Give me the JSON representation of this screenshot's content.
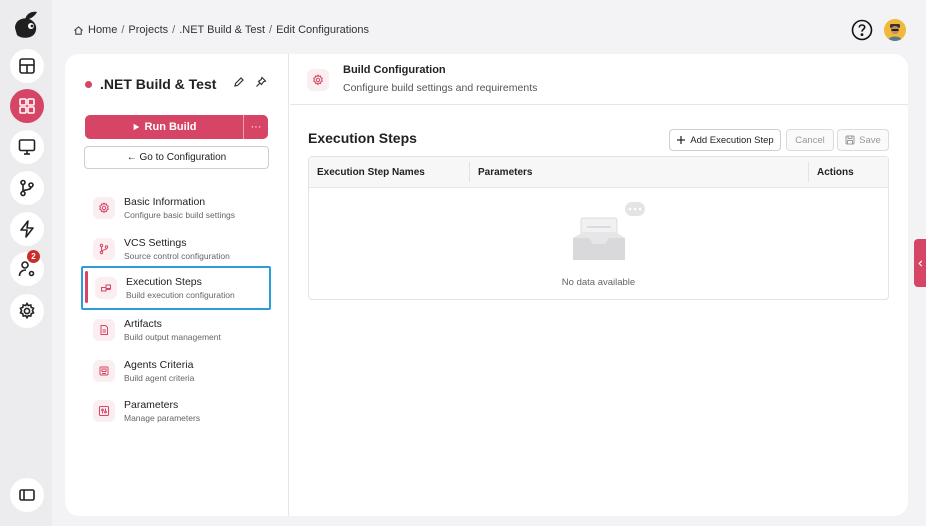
{
  "breadcrumb": {
    "items": [
      "Home",
      "Projects",
      ".NET Build & Test",
      "Edit Configurations"
    ],
    "separator": "/"
  },
  "rail": {
    "badge_count": "2",
    "accent": "#d64565"
  },
  "project": {
    "title": ".NET Build & Test",
    "run_label": "Run Build",
    "more_label": "···",
    "goto_label": "← Go to Configuration"
  },
  "nav": [
    {
      "label": "Basic Information",
      "sub": "Configure basic build settings",
      "icon": "gear-icon"
    },
    {
      "label": "VCS Settings",
      "sub": "Source control configuration",
      "icon": "branch-icon"
    },
    {
      "label": "Execution Steps",
      "sub": "Build execution configuration",
      "icon": "steps-icon"
    },
    {
      "label": "Artifacts",
      "sub": "Build output management",
      "icon": "file-icon"
    },
    {
      "label": "Agents Criteria",
      "sub": "Build agent criteria",
      "icon": "agent-icon"
    },
    {
      "label": "Parameters",
      "sub": "Manage parameters",
      "icon": "params-icon"
    }
  ],
  "header": {
    "title": "Build Configuration",
    "subtitle": "Configure build settings and requirements"
  },
  "main": {
    "section_title": "Execution Steps",
    "add_label": "Add Execution Step",
    "cancel_label": "Cancel",
    "save_label": "Save",
    "columns": [
      "Execution Step Names",
      "Parameters",
      "Actions"
    ],
    "empty_text": "No data available"
  }
}
